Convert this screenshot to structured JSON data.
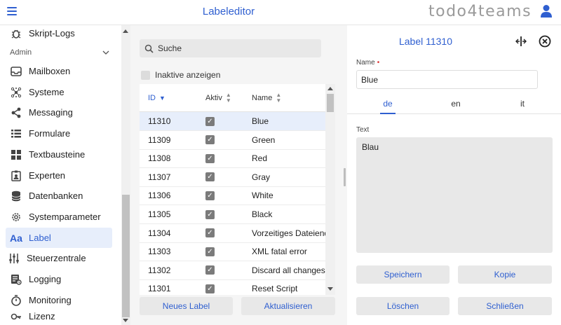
{
  "header": {
    "title": "Labeleditor",
    "brand": "todo4teams",
    "colors": {
      "accent": "#2f5fd0",
      "brand_text": "#9a9a9a"
    }
  },
  "sidebar": {
    "section_label": "Admin",
    "items": [
      {
        "label": "Skript-Logs",
        "icon": "bug-icon"
      },
      {
        "label": "Mailboxen",
        "icon": "inbox-icon"
      },
      {
        "label": "Systeme",
        "icon": "hub-icon"
      },
      {
        "label": "Messaging",
        "icon": "share-icon"
      },
      {
        "label": "Formulare",
        "icon": "list-icon"
      },
      {
        "label": "Textbausteine",
        "icon": "grid-icon"
      },
      {
        "label": "Experten",
        "icon": "badge-icon"
      },
      {
        "label": "Datenbanken",
        "icon": "database-icon"
      },
      {
        "label": "Systemparameter",
        "icon": "gear-icon"
      },
      {
        "label": "Label",
        "icon": "text-aa-icon",
        "active": true
      },
      {
        "label": "Steuerzentrale",
        "icon": "sliders-icon"
      },
      {
        "label": "Logging",
        "icon": "log-icon"
      },
      {
        "label": "Monitoring",
        "icon": "timer-icon"
      },
      {
        "label": "Lizenz",
        "icon": "key-icon"
      }
    ]
  },
  "list": {
    "search_placeholder": "Suche",
    "inactive_label": "Inaktive anzeigen",
    "columns": {
      "id": "ID",
      "active": "Aktiv",
      "name": "Name"
    },
    "rows": [
      {
        "id": "11310",
        "active": true,
        "name": "Blue",
        "selected": true
      },
      {
        "id": "11309",
        "active": true,
        "name": "Green"
      },
      {
        "id": "11308",
        "active": true,
        "name": "Red"
      },
      {
        "id": "11307",
        "active": true,
        "name": "Gray"
      },
      {
        "id": "11306",
        "active": true,
        "name": "White"
      },
      {
        "id": "11305",
        "active": true,
        "name": "Black"
      },
      {
        "id": "11304",
        "active": true,
        "name": "Vorzeitiges Dateiende"
      },
      {
        "id": "11303",
        "active": true,
        "name": "XML fatal error"
      },
      {
        "id": "11302",
        "active": true,
        "name": "Discard all changes?"
      },
      {
        "id": "11301",
        "active": true,
        "name": "Reset Script"
      }
    ],
    "buttons": {
      "new": "Neues Label",
      "refresh": "Aktualisieren"
    }
  },
  "editor": {
    "title": "Label 11310",
    "name_label": "Name",
    "name_required_mark": "•",
    "name_value": "Blue",
    "languages": [
      {
        "code": "de",
        "active": true
      },
      {
        "code": "en"
      },
      {
        "code": "it"
      }
    ],
    "text_label": "Text",
    "text_value": "Blau",
    "buttons": {
      "save": "Speichern",
      "copy": "Kopie",
      "delete": "Löschen",
      "close": "Schließen"
    }
  }
}
